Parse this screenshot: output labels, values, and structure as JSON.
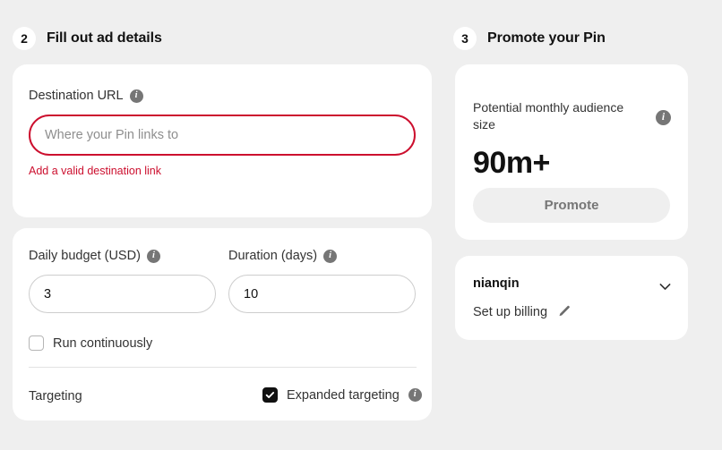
{
  "steps": {
    "ad_details": {
      "number": "2",
      "title": "Fill out ad details"
    },
    "promote": {
      "number": "3",
      "title": "Promote your Pin"
    }
  },
  "ad_details": {
    "destination": {
      "label": "Destination URL",
      "info_icon": "info-icon",
      "placeholder": "Where your Pin links to",
      "value": "",
      "error": "Add a valid destination link"
    },
    "daily_budget": {
      "label": "Daily budget (USD)",
      "info_icon": "info-icon",
      "value": "3",
      "placeholder": ""
    },
    "duration": {
      "label": "Duration (days)",
      "info_icon": "info-icon",
      "value": "10",
      "placeholder": ""
    },
    "run_continuously": {
      "label": "Run continuously",
      "checked": false
    },
    "targeting_label": "Targeting",
    "expanded_targeting": {
      "label": "Expanded targeting",
      "checked": true,
      "info_icon": "info-icon"
    }
  },
  "promote_panel": {
    "audience_label": "Potential monthly audience size",
    "audience_info_icon": "info-icon",
    "audience_value": "90m+",
    "promote_button": "Promote",
    "account_name": "nianqin",
    "account_chevron_icon": "chevron-down-icon",
    "billing_text": "Set up billing",
    "billing_edit_icon": "pencil-icon"
  },
  "colors": {
    "background": "#efefef",
    "card": "#ffffff",
    "error_red": "#cc0f2e",
    "text_primary": "#111111",
    "text_secondary": "#333333",
    "icon_gray": "#767676",
    "border_gray": "#cdcdcd"
  }
}
